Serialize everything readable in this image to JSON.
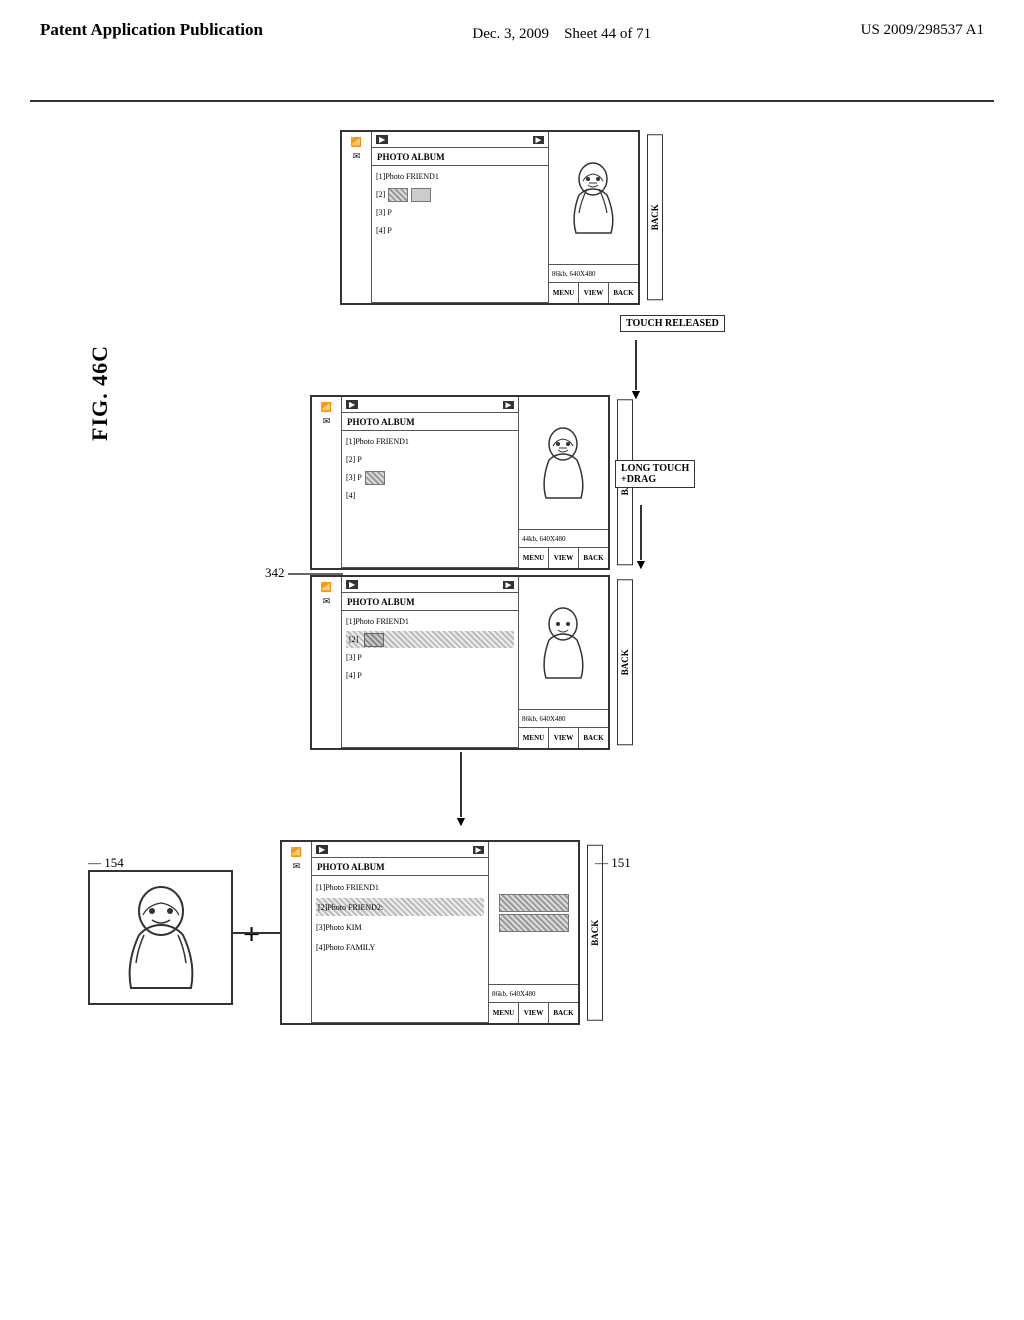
{
  "header": {
    "left": "Patent Application Publication",
    "middle_line1": "Dec. 3, 2009",
    "middle_line2": "Sheet 44 of 71",
    "right": "US 2009/298537 A1"
  },
  "figure": {
    "label": "FIG. 46C"
  },
  "annotations": {
    "ref342": "342",
    "ref154": "154",
    "ref151": "151",
    "touch_released": "TOUCH RELEASED",
    "long_touch": "LONG TOUCH\n+DRAG"
  },
  "phone_common": {
    "title": "PHOTO ALBUM",
    "menu": "MENU",
    "view": "VIEW",
    "back": "BACK",
    "info_top": "86kb, 640X480",
    "info_mid": "44kb, 640X480",
    "item1": "[1]Photo FRIEND1",
    "item2": "[2]",
    "item3": "[3] P",
    "item4": "[4] P",
    "item2_mid": "[2] P",
    "item4_mid": "[4]",
    "item1_bot": "[1]Photo FRIEND1",
    "item2_bot_highlight": "[2]Photo FRIEND2:",
    "item3_bot": "[3]Photo KIM",
    "item4_bot": "[4]Photo FAMILY"
  }
}
